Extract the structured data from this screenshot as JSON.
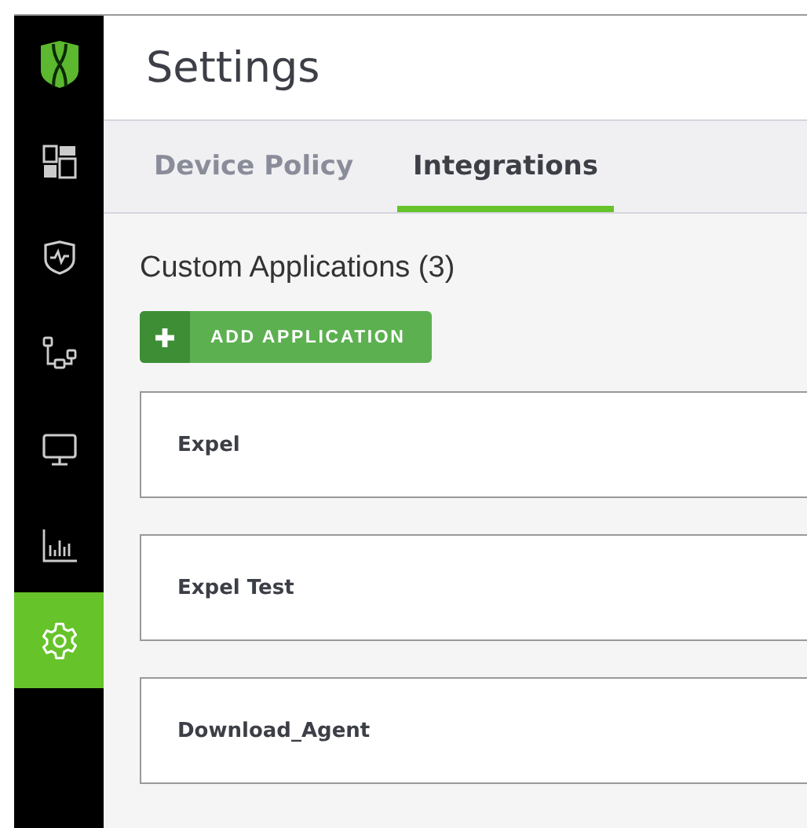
{
  "sidebar": {
    "items": [
      {
        "kind": "dashboard",
        "selected": false
      },
      {
        "kind": "shield",
        "selected": false
      },
      {
        "kind": "network",
        "selected": false
      },
      {
        "kind": "monitor",
        "selected": false
      },
      {
        "kind": "chart",
        "selected": false
      },
      {
        "kind": "settings",
        "selected": true
      }
    ]
  },
  "header": {
    "title": "Settings"
  },
  "tabs": [
    {
      "label": "Device Policy",
      "selected": false
    },
    {
      "label": "Integrations",
      "selected": true
    }
  ],
  "section": {
    "title": "Custom Applications (3)",
    "add_button": "ADD APPLICATION"
  },
  "applications": [
    {
      "name": "Expel"
    },
    {
      "name": "Expel Test"
    },
    {
      "name": "Download_Agent"
    }
  ]
}
